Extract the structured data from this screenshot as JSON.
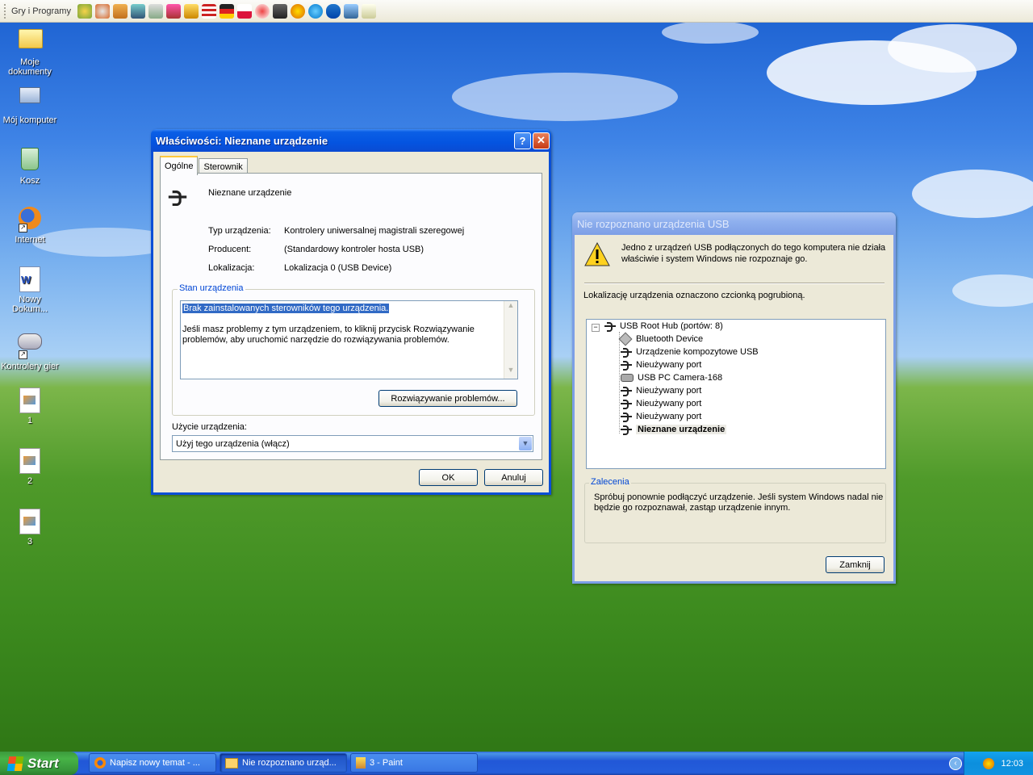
{
  "quickbar": {
    "title": "Gry i Programy",
    "icons": [
      "game-icon",
      "firefox-icon",
      "drive-icon",
      "media-icon",
      "tool-icon",
      "sound-icon",
      "pencil-icon",
      "flag-usa-icon",
      "flag-germany-icon",
      "flag-poland-icon",
      "record-icon",
      "camera-icon",
      "sun-icon",
      "skype-icon",
      "bluetooth-icon",
      "network-icon",
      "notes-icon"
    ]
  },
  "desktop": {
    "icons": [
      {
        "label1": "Moje",
        "label2": "dokumenty"
      },
      {
        "label1": "Mój komputer",
        "label2": ""
      },
      {
        "label1": "Kosz",
        "label2": ""
      },
      {
        "label1": "Internet",
        "label2": ""
      },
      {
        "label1": "Nowy",
        "label2": "Dokum..."
      },
      {
        "label1": "Kontrolery gier",
        "label2": ""
      },
      {
        "label1": "1",
        "label2": ""
      },
      {
        "label1": "2",
        "label2": ""
      },
      {
        "label1": "3",
        "label2": ""
      }
    ]
  },
  "props": {
    "title": "Właściwości: Nieznane urządzenie",
    "tabs": [
      "Ogólne",
      "Sterownik"
    ],
    "device_name": "Nieznane urządzenie",
    "rows": [
      {
        "k": "Typ urządzenia:",
        "v": "Kontrolery uniwersalnej magistrali szeregowej"
      },
      {
        "k": "Producent:",
        "v": "(Standardowy kontroler hosta USB)"
      },
      {
        "k": "Lokalizacja:",
        "v": "Lokalizacja 0 (USB Device)"
      }
    ],
    "status_group": "Stan urządzenia",
    "status_line1": "Brak zainstalowanych sterowników tego urządzenia.",
    "status_line2": "Jeśli masz problemy z tym urządzeniem, to kliknij przycisk Rozwiązywanie",
    "status_line3": "problemów, aby uruchomić narzędzie do rozwiązywania problemów.",
    "troubleshoot": "Rozwiązywanie problemów...",
    "usage_label": "Użycie urządzenia:",
    "usage_value": "Użyj tego urządzenia (włącz)",
    "ok": "OK",
    "cancel": "Anuluj"
  },
  "usb": {
    "title": "Nie rozpoznano urządzenia USB",
    "message1": "Jedno z urządzeń USB podłączonych do tego komputera nie działa",
    "message2": "właściwie i system Windows nie rozpoznaje go.",
    "hint": "Lokalizację urządzenia oznaczono czcionką pogrubioną.",
    "root": "USB Root Hub (portów: 8)",
    "children": [
      "Bluetooth Device",
      "Urządzenie kompozytowe USB",
      "Nieużywany port",
      "USB PC Camera-168",
      "Nieużywany port",
      "Nieużywany port",
      "Nieużywany port",
      "Nieznane urządzenie"
    ],
    "rec_title": "Zalecenia",
    "rec1": "Spróbuj ponownie podłączyć urządzenie. Jeśli system Windows nadal nie",
    "rec2": "będzie go rozpoznawał, zastąp urządzenie innym.",
    "close": "Zamknij"
  },
  "taskbar": {
    "start": "Start",
    "tasks": [
      "Napisz nowy temat - ...",
      "Nie rozpoznano urząd...",
      "3 - Paint"
    ],
    "clock": "12:03"
  }
}
